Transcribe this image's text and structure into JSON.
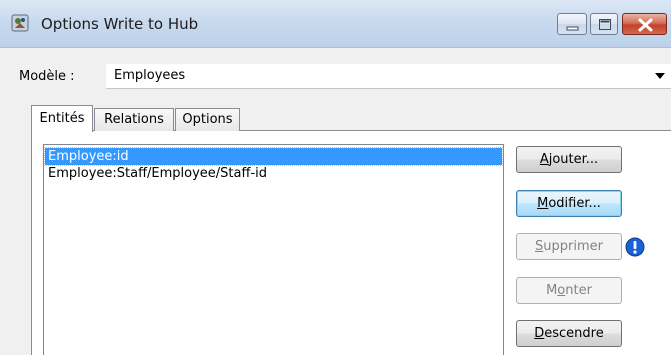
{
  "window": {
    "title": "Options Write to Hub",
    "controls": {
      "minimize": "minimize",
      "maximize": "maximize",
      "close": "close"
    }
  },
  "model": {
    "label": "Modèle :",
    "value": "Employees"
  },
  "tabs": [
    {
      "label": "Entités",
      "active": true
    },
    {
      "label": "Relations",
      "active": false
    },
    {
      "label": "Options",
      "active": false
    }
  ],
  "entities": {
    "items": [
      {
        "text": "Employee:id",
        "selected": true
      },
      {
        "text": "Employee:Staff/Employee/Staff-id",
        "selected": false
      }
    ]
  },
  "buttons": {
    "add": {
      "mnemonic": "A",
      "rest": "jouter..."
    },
    "modify": {
      "mnemonic": "M",
      "rest": "odifier..."
    },
    "delete": {
      "mnemonic": "S",
      "rest": "upprimer"
    },
    "up": {
      "pre": "M",
      "mnemonic": "o",
      "rest": "nter"
    },
    "down": {
      "mnemonic": "D",
      "rest": "escendre"
    }
  },
  "colors": {
    "selection": "#3399ff",
    "info_icon": "#1c61d6"
  },
  "icons": {
    "app": "app-icon",
    "info": "info-icon"
  }
}
